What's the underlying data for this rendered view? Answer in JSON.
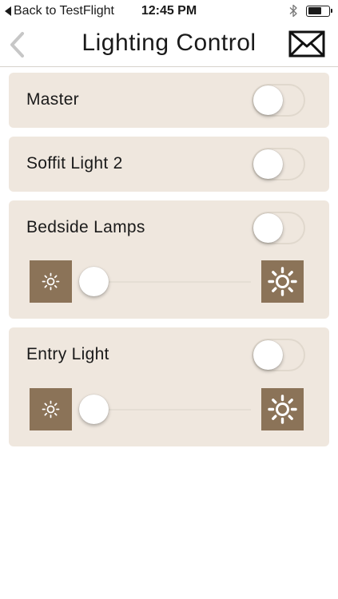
{
  "status_bar": {
    "back_label": "Back to TestFlight",
    "time": "12:45 PM",
    "battery_level": 0.65
  },
  "nav": {
    "title": "Lighting Control",
    "back_icon": "chevron-left-icon",
    "mail_icon": "mail-icon"
  },
  "colors": {
    "card_bg": "#efe7de",
    "accent_brown": "#8b7358"
  },
  "lights": [
    {
      "label": "Master",
      "on": false
    },
    {
      "label": "Soffit Light 2",
      "on": false
    },
    {
      "label": "Bedside Lamps",
      "on": false,
      "dimmer": 0.0
    },
    {
      "label": "Entry Light",
      "on": false,
      "dimmer": 0.0
    }
  ]
}
